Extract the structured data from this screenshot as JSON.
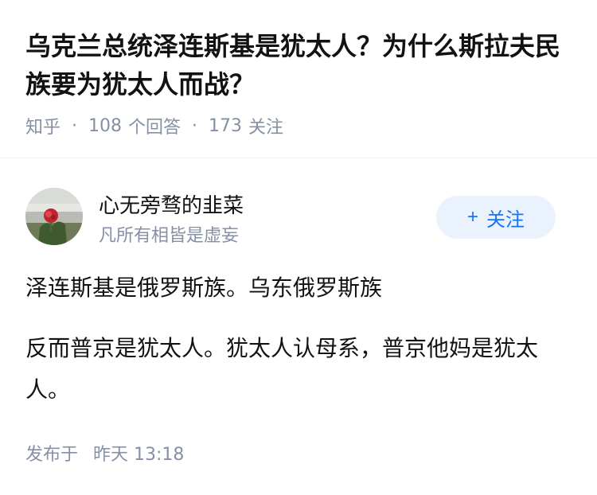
{
  "question": {
    "title": "乌克兰总统泽连斯基是犹太人？为什么斯拉夫民族要为犹太人而战？",
    "source": "知乎",
    "answers_count": "108",
    "answers_label": "个回答",
    "followers_count": "173",
    "followers_label": "关注"
  },
  "author": {
    "name": "心无旁骛的韭菜",
    "bio": "凡所有相皆是虚妄",
    "follow_icon": "+",
    "follow_label": "关注"
  },
  "answer": {
    "paragraphs": [
      "泽连斯基是俄罗斯族。乌东俄罗斯族",
      "反而普京是犹太人。犹太人认母系，普京他妈是犹太人。"
    ],
    "published_label": "发布于",
    "published_time": "昨天 13:18"
  },
  "colors": {
    "accent": "#1772f6",
    "muted": "#8590a6",
    "follow_bg": "#eaf3fd"
  }
}
